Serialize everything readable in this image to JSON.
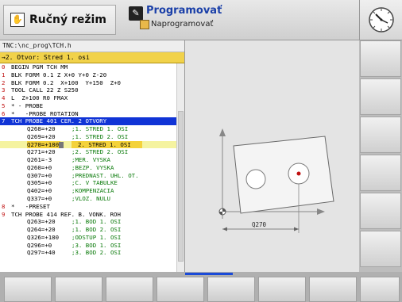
{
  "header": {
    "mode_manual": {
      "icon": "hand-icon",
      "label": "Ručný režim"
    },
    "mode_program": {
      "icon": "program-icon",
      "label": "Programovať",
      "sub_icon": "edit-icon",
      "sub_label": "Naprogramovať"
    },
    "clock_icon": "clock-icon"
  },
  "program": {
    "path": "TNC:\\nc_prog\\TCH.h",
    "step": "→2. Otvor: Stred 1. osi",
    "lines": [
      {
        "no": "0",
        "text": "BEGIN PGM TCH MM"
      },
      {
        "no": "1",
        "text": "BLK FORM 0.1 Z X+0 Y+0 Z-20"
      },
      {
        "no": "2",
        "text": "BLK FORM 0.2  X+100  Y+150  Z+0"
      },
      {
        "no": "3",
        "text": "TOOL CALL 22 Z S250"
      },
      {
        "no": "4",
        "text": "L  Z+100 R0 FMAX"
      },
      {
        "no": "5",
        "text": "* - PROBE"
      },
      {
        "no": "6",
        "text": "*   -PROBE ROTATION"
      },
      {
        "no": "7",
        "text": "TCH PROBE 401 CER. 2 OTVORY",
        "selected": true
      },
      {
        "no": "",
        "text": "Q268=+20",
        "comment": ";1. STRED 1. OSI",
        "sub": true
      },
      {
        "no": "",
        "text": "Q269=+20",
        "comment": ";1. STRED 2. OSI",
        "sub": true
      },
      {
        "no": "",
        "text": "Q270=+180",
        "comment": "2. STRED 1. OSI",
        "sub": true,
        "highlight": true
      },
      {
        "no": "",
        "text": "Q271=+20",
        "comment": ";2. STRED 2. OSI",
        "sub": true
      },
      {
        "no": "",
        "text": "Q261=-3",
        "comment": ";MER. VYSKA",
        "sub": true
      },
      {
        "no": "",
        "text": "Q260=+0",
        "comment": ";BEZP. VYSKA",
        "sub": true
      },
      {
        "no": "",
        "text": "Q307=+0",
        "comment": ";PREDNAST. UHL. OT.",
        "sub": true
      },
      {
        "no": "",
        "text": "Q305=+0",
        "comment": ";C. V TABULKE",
        "sub": true
      },
      {
        "no": "",
        "text": "Q402=+0",
        "comment": ";KOMPENZACIA",
        "sub": true
      },
      {
        "no": "",
        "text": "Q337=+0",
        "comment": ";VLOZ. NULU",
        "sub": true
      },
      {
        "no": "8",
        "text": "*   -PRESET"
      },
      {
        "no": "9",
        "text": "TCH PROBE 414 REF. B. VONK. ROH"
      },
      {
        "no": "",
        "text": "Q263=+20",
        "comment": ";1. BOD 1. OSI",
        "sub": true
      },
      {
        "no": "",
        "text": "Q264=+20",
        "comment": ";1. BOD 2. OSI",
        "sub": true
      },
      {
        "no": "",
        "text": "Q326=+180",
        "comment": ";ODSTUP 1. OSI",
        "sub": true
      },
      {
        "no": "",
        "text": "Q296=+0",
        "comment": ";3. BOD 1. OSI",
        "sub": true
      },
      {
        "no": "",
        "text": "Q297=+40",
        "comment": ";3. BOD 2. OSI",
        "sub": true
      }
    ]
  },
  "graphic": {
    "dimension_label": "Q270"
  },
  "colors": {
    "selection": "#1034d6",
    "highlight": "#f4d23a",
    "step_bar": "#f1d24a",
    "line_number": "#c01010",
    "comment": "#0a7a0a",
    "softkey_indicator": "#1a4ad8"
  }
}
